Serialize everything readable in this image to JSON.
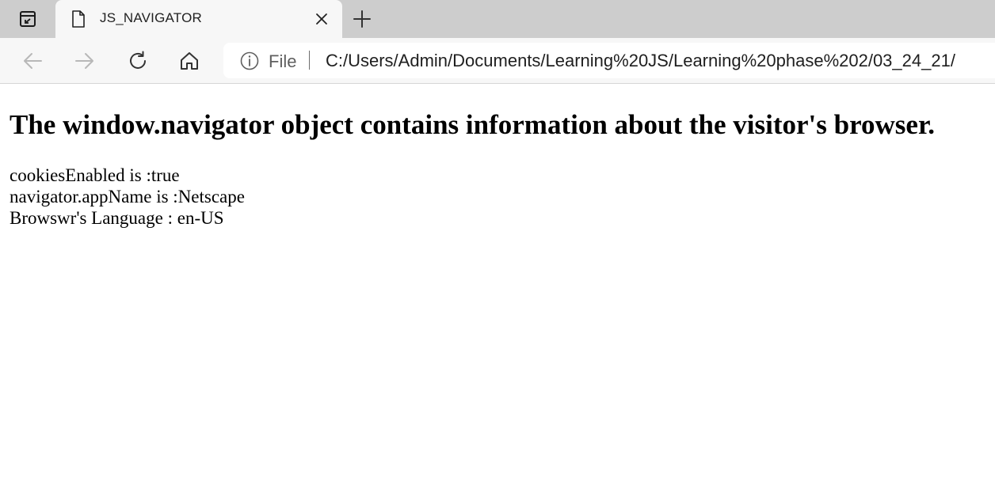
{
  "browser": {
    "tab": {
      "title": "JS_NAVIGATOR"
    },
    "icons": {
      "tab_actions": "tab-actions-icon",
      "favicon": "page-icon",
      "close": "close-icon",
      "new_tab": "plus-icon",
      "back": "back-arrow-icon",
      "forward": "forward-arrow-icon",
      "refresh": "refresh-icon",
      "home": "home-icon",
      "site_info": "info-icon"
    },
    "address_bar": {
      "scheme_label": "File",
      "url": "C:/Users/Admin/Documents/Learning%20JS/Learning%20phase%202/03_24_21/"
    }
  },
  "page": {
    "heading": "The window.navigator object contains information about the visitor's browser.",
    "lines": [
      "cookiesEnabled is :true",
      "navigator.appName is :Netscape",
      "Browswr's Language : en-US"
    ]
  },
  "colors": {
    "tabstrip_bg": "#cdcdcd",
    "toolbar_bg": "#f7f7f7",
    "page_bg": "#ffffff"
  }
}
